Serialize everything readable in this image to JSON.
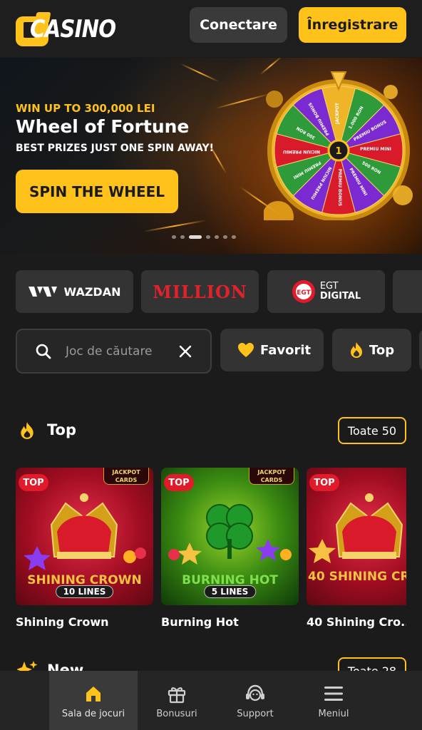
{
  "header": {
    "logo_text": "CASINO",
    "login_label": "Conectare",
    "register_label": "Înregistrare"
  },
  "banner": {
    "eyebrow": "WIN UP TO 300,000 LEI",
    "title": "Wheel of Fortune",
    "subtitle": "BEST PRIZES JUST ONE SPIN AWAY!",
    "cta_label": "SPIN THE WHEEL",
    "wheel_segments": [
      "JACKPOT",
      "1.000 RON",
      "PREMIU BONUS",
      "PREMIU MINI",
      "500 RON",
      "PREMIU MINI",
      "PREMIU BONUS",
      "NICIUN PREMIU",
      "PREMIU MINI",
      "NICIUN PREMIU",
      "300 RON",
      "PREMIU BONUS"
    ],
    "slide_count": 7,
    "active_slide": 3
  },
  "providers": [
    {
      "name": "WAZDAN"
    },
    {
      "name": "MILLION"
    },
    {
      "name": "EGT",
      "sub": "DIGITAL"
    }
  ],
  "search": {
    "placeholder": "Joc de căutare"
  },
  "filters": {
    "favorite_label": "Favorit",
    "top_label": "Top"
  },
  "top_section": {
    "title": "Top",
    "see_all_label": "Toate 50",
    "games": [
      {
        "name": "Shining Crown",
        "badge": "TOP",
        "art_title": "SHINING CROWN",
        "art_lines": "10 LINES",
        "jackpot": "JACKPOT CARDS"
      },
      {
        "name": "Burning Hot",
        "badge": "TOP",
        "art_title": "BURNING HOT",
        "art_lines": "5 LINES",
        "jackpot": "JACKPOT CARDS"
      },
      {
        "name": "40 Shining Cro...",
        "badge": "TOP",
        "art_title": "40 SHINING CR"
      }
    ]
  },
  "new_section": {
    "title": "New",
    "see_all_label": "Toate 28"
  },
  "bottom_nav": [
    {
      "label": "Sala de jocuri",
      "icon": "home-icon",
      "active": true
    },
    {
      "label": "Bonusuri",
      "icon": "gift-icon",
      "active": false
    },
    {
      "label": "Support",
      "icon": "headset-icon",
      "active": false
    },
    {
      "label": "Meniul",
      "icon": "menu-icon",
      "active": false
    }
  ],
  "colors": {
    "accent": "#ffc21a",
    "background": "#1b1b1b",
    "badge_red": "#e21a2a"
  }
}
